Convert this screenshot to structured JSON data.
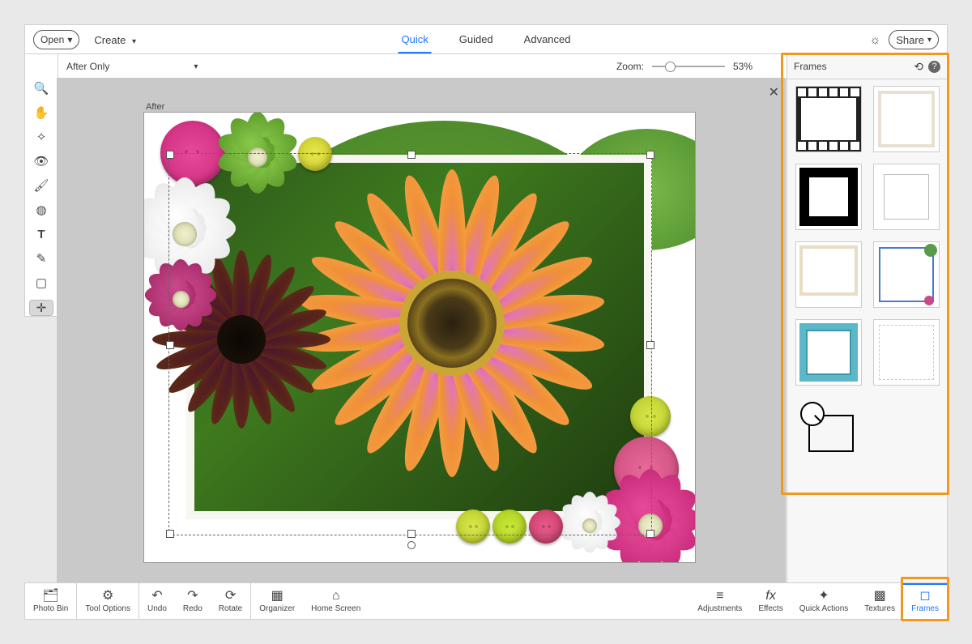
{
  "top": {
    "open": "Open",
    "create": "Create",
    "tabs": [
      "Quick",
      "Guided",
      "Advanced"
    ],
    "activeTab": 0,
    "share": "Share"
  },
  "sub": {
    "viewMode": "After Only",
    "zoomLabel": "Zoom:",
    "zoomValue": "53%"
  },
  "canvas": {
    "afterLabel": "After"
  },
  "framesPanel": {
    "title": "Frames",
    "thumbs": [
      "film-strip",
      "paper-light",
      "black-bold",
      "thin-line",
      "polaroid-tan",
      "blue-dots",
      "teal-check",
      "scallop",
      "magnifier"
    ]
  },
  "bottom": {
    "left": [
      "Photo Bin",
      "Tool Options",
      "Undo",
      "Redo",
      "Rotate",
      "Organizer",
      "Home Screen"
    ],
    "right": [
      "Adjustments",
      "Effects",
      "Quick Actions",
      "Textures",
      "Frames"
    ],
    "active": "Frames"
  },
  "tools": [
    "zoom",
    "hand",
    "wand",
    "eye",
    "brush",
    "spot",
    "type",
    "eyedropper",
    "crop",
    "move"
  ]
}
